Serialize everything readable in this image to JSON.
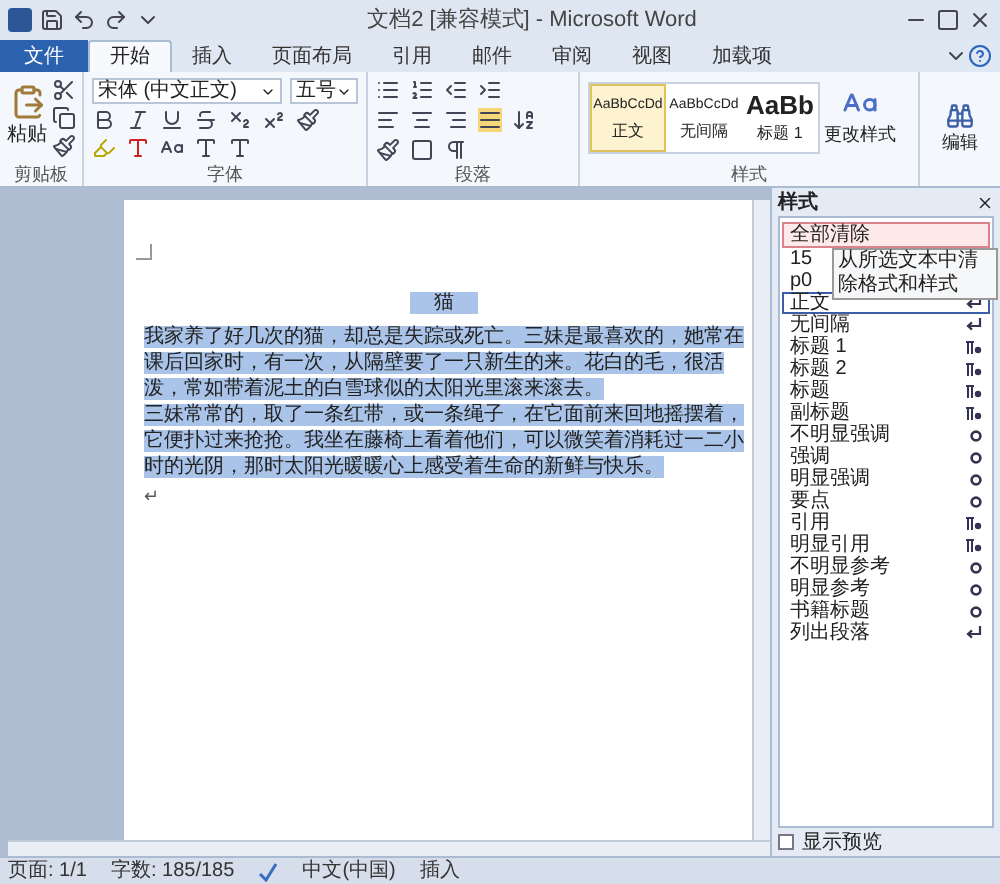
{
  "window": {
    "title": "文档2 [兼容模式] - Microsoft Word"
  },
  "tabs": [
    {
      "label": "文件",
      "kind": "file",
      "selected": false
    },
    {
      "label": "开始",
      "kind": "tab",
      "selected": true
    },
    {
      "label": "插入",
      "kind": "tab",
      "selected": false
    },
    {
      "label": "页面布局",
      "kind": "tab",
      "selected": false
    },
    {
      "label": "引用",
      "kind": "tab",
      "selected": false
    },
    {
      "label": "邮件",
      "kind": "tab",
      "selected": false
    },
    {
      "label": "审阅",
      "kind": "tab",
      "selected": false
    },
    {
      "label": "视图",
      "kind": "tab",
      "selected": false
    },
    {
      "label": "加载项",
      "kind": "tab",
      "selected": false
    }
  ],
  "ribbon": {
    "clipboard": {
      "paste": "粘贴",
      "label": "剪贴板"
    },
    "font": {
      "name": "宋体 (中文正文)",
      "size": "五号",
      "label": "字体"
    },
    "paragraph": {
      "label": "段落"
    },
    "styles": {
      "gallery": [
        {
          "preview": "AaBbCcDd",
          "name": "正文",
          "kind": "small",
          "selected": true
        },
        {
          "preview": "AaBbCcDd",
          "name": "无间隔",
          "kind": "small",
          "selected": false
        },
        {
          "preview": "AaBb",
          "name": "标题 1",
          "kind": "large",
          "selected": false
        }
      ],
      "change": "更改样式",
      "label": "样式"
    },
    "editing": {
      "label": "编辑"
    }
  },
  "document": {
    "paragraphs": [
      {
        "text": "猫",
        "kind": "title",
        "selected": true
      },
      {
        "text": "我家养了好几次的猫，却总是失踪或死亡。三妹是最喜欢的，她常在课后回家时，有一次，从隔壁要了一只新生的来。花白的毛，很活泼，常如带着泥土的白雪球似的太阳光里滚来滚去。",
        "kind": "body",
        "selected": true
      },
      {
        "text": "三妹常常的，取了一条红带，或一条绳子，在它面前来回地摇摆着，它便扑过来抢抢。我坐在藤椅上看着他们，可以微笑着消耗过一二小时的光阴，那时太阳光暖暖心上感受着生命的新鲜与快乐。",
        "kind": "body",
        "selected": true
      },
      {
        "text": "↵",
        "kind": "mark",
        "selected": false
      }
    ]
  },
  "styles_pane": {
    "title": "样式",
    "items": [
      {
        "name": "全部清除",
        "kind": "clear",
        "selected": true
      },
      {
        "name": "15",
        "selected": false
      },
      {
        "name": "p0",
        "selected": false
      },
      {
        "name": "正文",
        "kind": "paragraph",
        "selected": false,
        "current": true
      },
      {
        "name": "无间隔",
        "kind": "paragraph",
        "selected": false
      },
      {
        "name": "标题 1",
        "kind": "linked",
        "selected": false
      },
      {
        "name": "标题 2",
        "kind": "linked",
        "selected": false
      },
      {
        "name": "标题",
        "kind": "linked",
        "selected": false
      },
      {
        "name": "副标题",
        "kind": "linked",
        "selected": false
      },
      {
        "name": "不明显强调",
        "kind": "character",
        "selected": false
      },
      {
        "name": "强调",
        "kind": "character",
        "selected": false
      },
      {
        "name": "明显强调",
        "kind": "character",
        "selected": false
      },
      {
        "name": "要点",
        "kind": "character",
        "selected": false
      },
      {
        "name": "引用",
        "kind": "linked",
        "selected": false
      },
      {
        "name": "明显引用",
        "kind": "linked",
        "selected": false
      },
      {
        "name": "不明显参考",
        "kind": "character",
        "selected": false
      },
      {
        "name": "明显参考",
        "kind": "character",
        "selected": false
      },
      {
        "name": "书籍标题",
        "kind": "character",
        "selected": false
      },
      {
        "name": "列出段落",
        "kind": "paragraph",
        "selected": false
      }
    ],
    "tooltip": "从所选文本中清除格式和样式",
    "preview": {
      "label": "显示预览",
      "checked": false
    }
  },
  "status_bar": {
    "page": "页面: 1/1",
    "words": "字数: 185/185",
    "language": "中文(中国)",
    "mode": "插入"
  }
}
